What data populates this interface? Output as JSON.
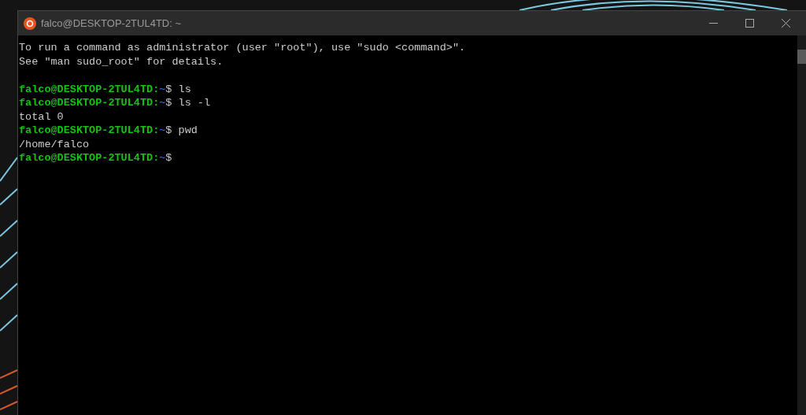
{
  "window": {
    "title": "falco@DESKTOP-2TUL4TD: ~"
  },
  "terminal": {
    "lines": [
      {
        "kind": "output",
        "text": "To run a command as administrator (user \"root\"), use \"sudo <command>\"."
      },
      {
        "kind": "output",
        "text": "See \"man sudo_root\" for details."
      },
      {
        "kind": "blank"
      },
      {
        "kind": "prompt",
        "user_host": "falco@DESKTOP-2TUL4TD:",
        "path": "~",
        "symbol": "$",
        "command": "ls"
      },
      {
        "kind": "prompt",
        "user_host": "falco@DESKTOP-2TUL4TD:",
        "path": "~",
        "symbol": "$",
        "command": "ls -l"
      },
      {
        "kind": "output",
        "text": "total 0"
      },
      {
        "kind": "prompt",
        "user_host": "falco@DESKTOP-2TUL4TD:",
        "path": "~",
        "symbol": "$",
        "command": "pwd"
      },
      {
        "kind": "output",
        "text": "/home/falco"
      },
      {
        "kind": "prompt",
        "user_host": "falco@DESKTOP-2TUL4TD:",
        "path": "~",
        "symbol": "$"
      }
    ]
  }
}
